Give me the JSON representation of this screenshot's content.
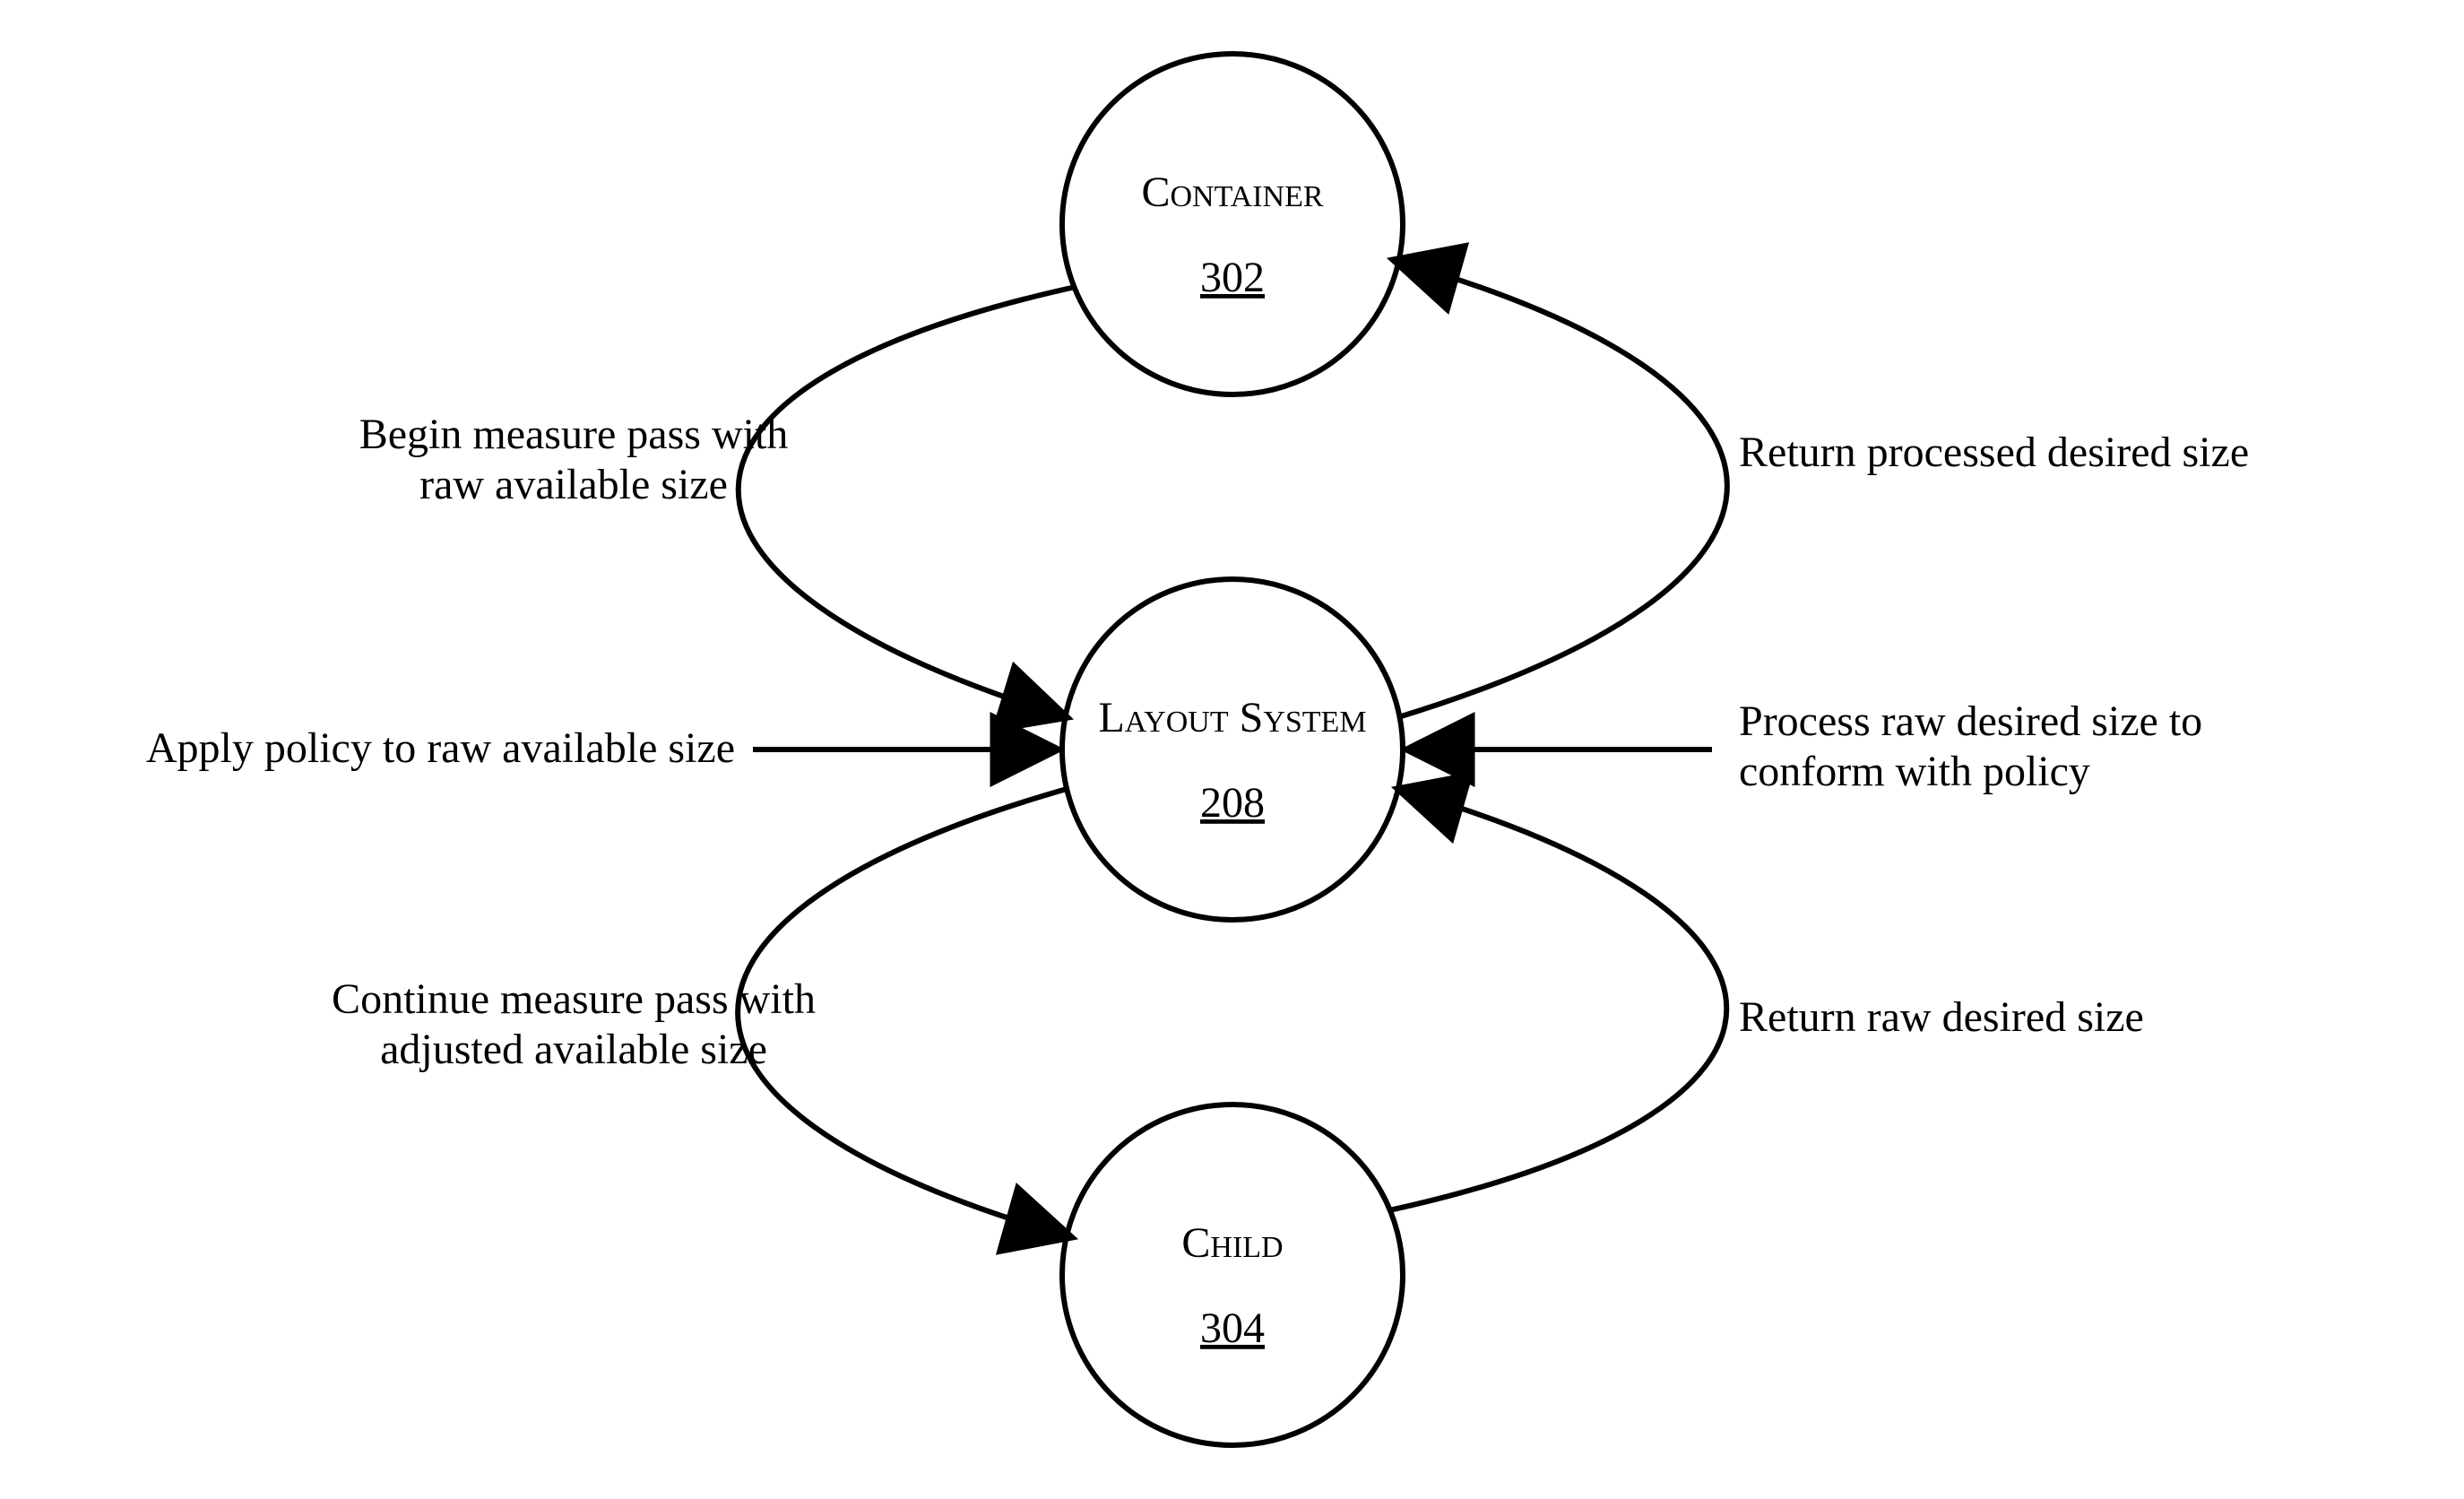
{
  "nodes": {
    "container": {
      "title": "Container",
      "ref": "302"
    },
    "layout": {
      "title": "Layout System",
      "ref": "208"
    },
    "child": {
      "title": "Child",
      "ref": "304"
    }
  },
  "edges": {
    "begin_measure": {
      "line1": "Begin measure pass with",
      "line2": "raw available size"
    },
    "apply_policy": {
      "line1": "Apply policy to raw available size"
    },
    "continue_measure": {
      "line1": "Continue measure pass with",
      "line2": "adjusted available size"
    },
    "return_processed": {
      "line1": "Return processed desired size"
    },
    "process_raw": {
      "line1": "Process raw desired size to",
      "line2": "conform with policy"
    },
    "return_raw": {
      "line1": "Return raw desired size"
    }
  }
}
